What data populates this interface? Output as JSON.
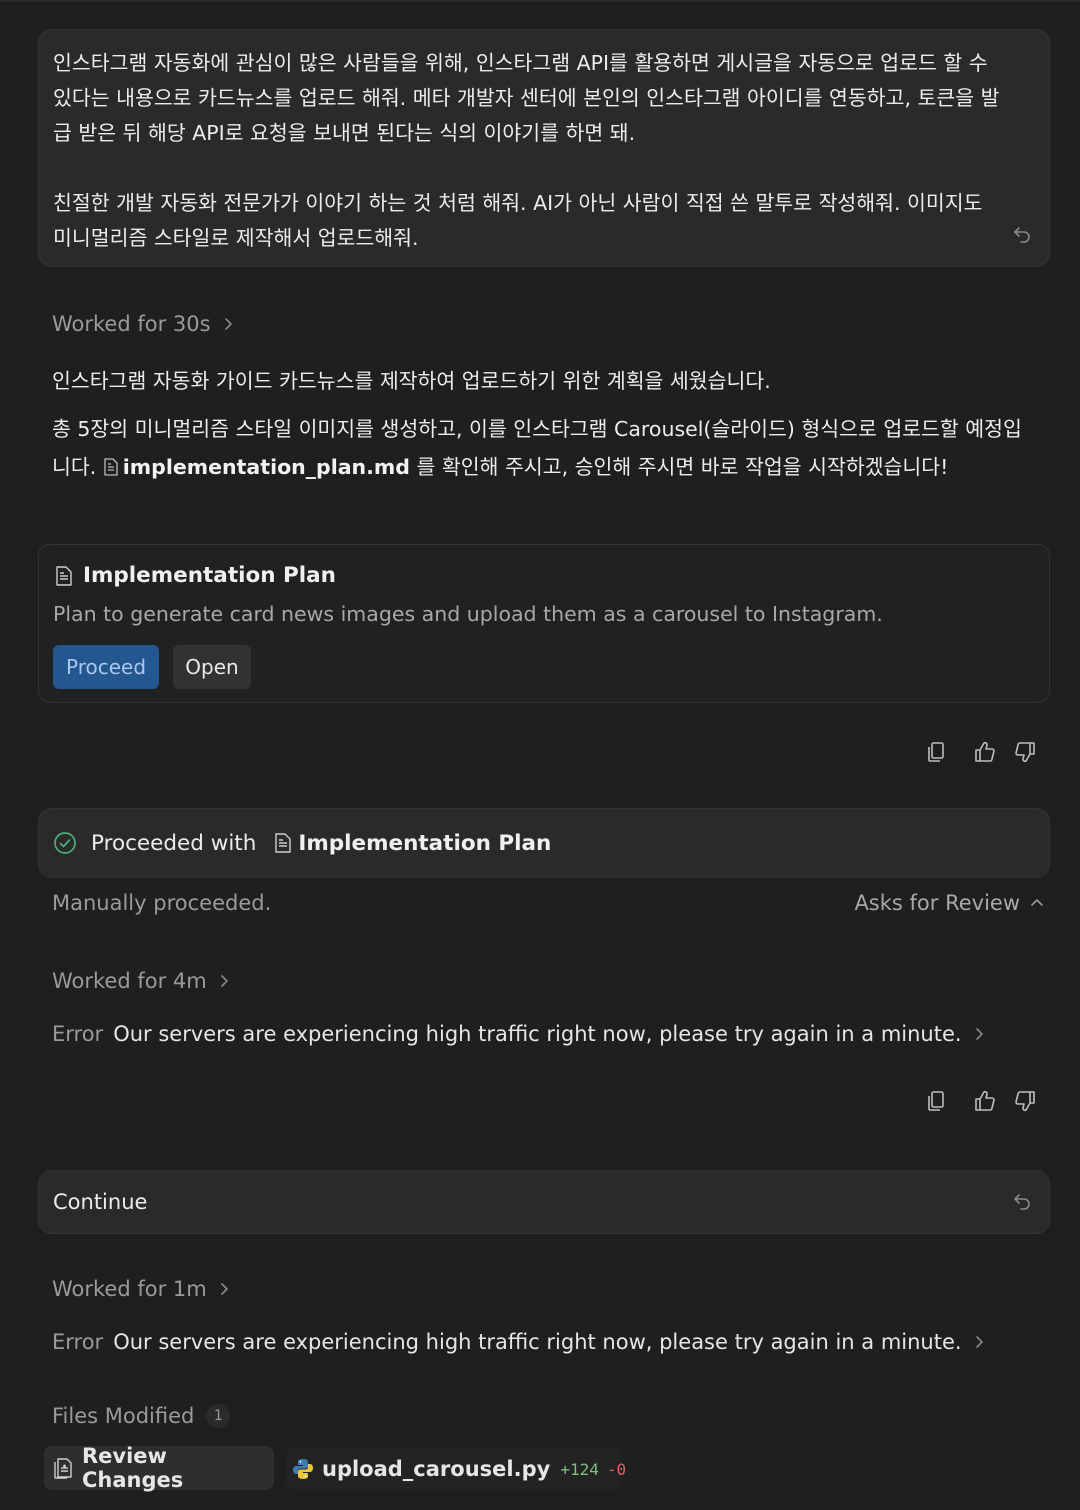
{
  "user_message": {
    "paragraph1": "인스타그램 자동화에 관심이 많은 사람들을 위해, 인스타그램 API를 활용하면 게시글을 자동으로 업로드 할 수 있다는 내용으로 카드뉴스를 업로드 해줘. 메타 개발자 센터에 본인의 인스타그램 아이디를 연동하고, 토큰을 발급 받은 뒤 해당 API로 요청을 보내면 된다는 식의 이야기를 하면 돼.",
    "paragraph2": "친절한 개발 자동화 전문가가 이야기 하는 것 처럼 해줘. AI가 아닌 사람이 직접 쓴 말투로 작성해줘. 이미지도 미니멀리즘 스타일로 제작해서 업로드해줘."
  },
  "step1": {
    "worked_label": "Worked for 30s",
    "response_line1": "인스타그램 자동화 가이드 카드뉴스를 제작하여 업로드하기 위한 계획을 세웠습니다.",
    "response_line2_pre": "총 5장의 미니멀리즘 스타일 이미지를 생성하고, 이를 인스타그램 Carousel(슬라이드) 형식으로 업로드할 예정입니다.",
    "file_ref": "implementation_plan.md",
    "response_line2_post": "를 확인해 주시고, 승인해 주시면 바로 작업을 시작하겠습니다!"
  },
  "plan_card": {
    "title": "Implementation Plan",
    "description": "Plan to generate card news images and upload them as a carousel to Instagram.",
    "proceed_label": "Proceed",
    "open_label": "Open"
  },
  "proceeded": {
    "label": "Proceeded with",
    "file": "Implementation Plan",
    "manual_text": "Manually proceeded.",
    "asks_label": "Asks for Review"
  },
  "step2": {
    "worked_label": "Worked for 4m",
    "error_label": "Error",
    "error_message": "Our servers are experiencing high traffic right now, please try again in a minute."
  },
  "continue_message": "Continue",
  "step3": {
    "worked_label": "Worked for 1m",
    "error_label": "Error",
    "error_message": "Our servers are experiencing high traffic right now, please try again in a minute."
  },
  "files": {
    "label": "Files Modified",
    "count": "1",
    "review_label": "Review Changes",
    "file_name": "upload_carousel.py",
    "added": "+124",
    "removed": "-0"
  },
  "colors": {
    "background": "#1f1f1f",
    "bubble": "#2a2a2a",
    "accent_button": "#24568f",
    "success_check": "#4caf7a",
    "added": "#7fbf7a",
    "removed": "#e06060"
  }
}
